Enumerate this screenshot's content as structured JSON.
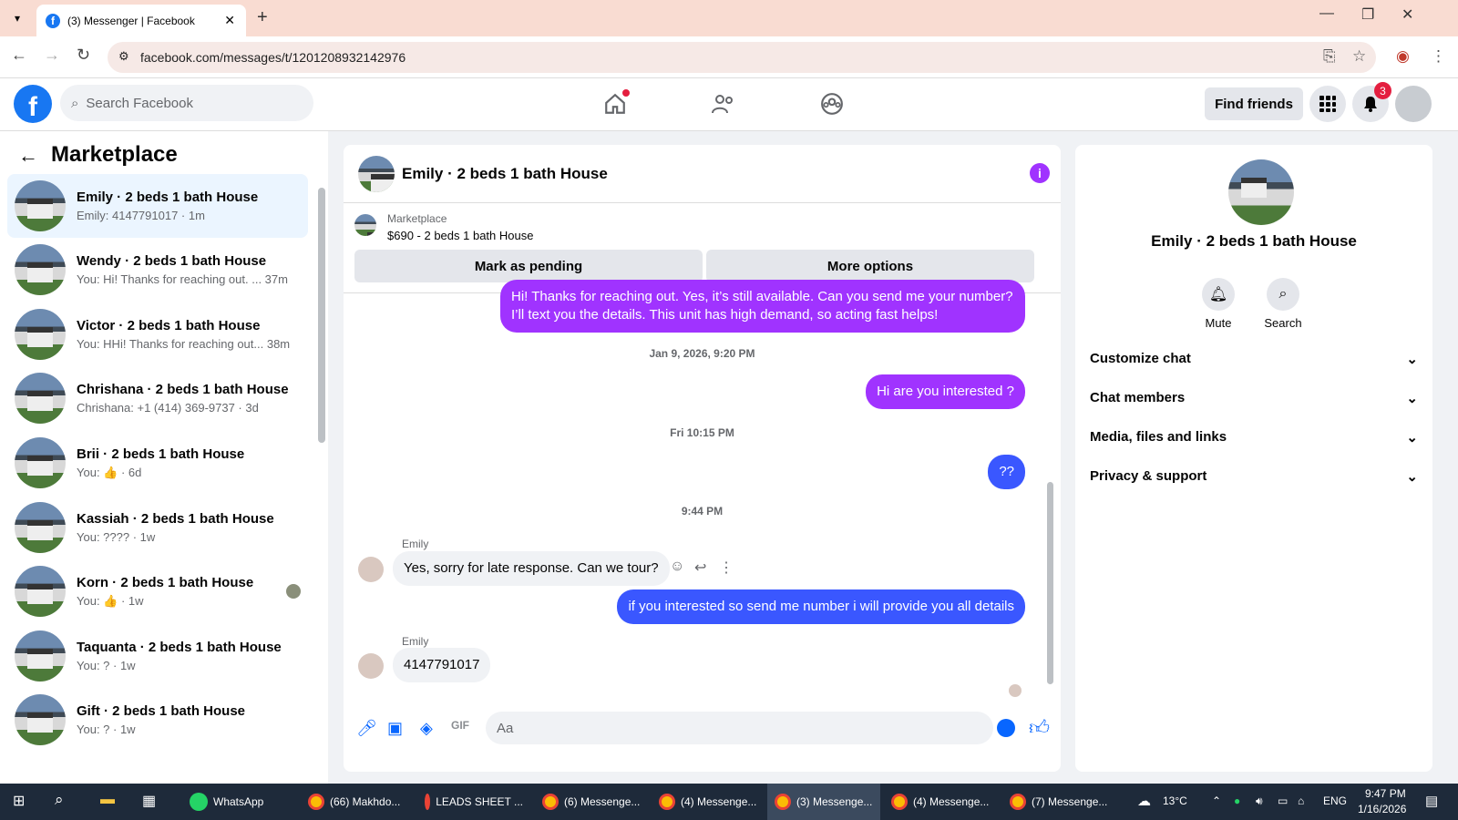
{
  "browser": {
    "tab_title": "(3) Messenger | Facebook",
    "tab_close": "✕",
    "new_tab": "+",
    "url": "facebook.com/messages/t/1201208932142976"
  },
  "fb_header": {
    "search_placeholder": "Search Facebook",
    "find_friends": "Find friends",
    "notif_count": "3"
  },
  "sidebar": {
    "title": "Marketplace",
    "conversations": [
      {
        "name": "Emily · 2 beds 1 bath House",
        "preview": "Emily: 4147791017 · 1m"
      },
      {
        "name": "Wendy · 2 beds 1 bath House",
        "preview": "You: Hi! Thanks for reaching out. ...   37m"
      },
      {
        "name": "Victor · 2 beds 1 bath House",
        "preview": "You: HHi! Thanks for reaching out...  38m"
      },
      {
        "name": "Chrishana · 2 beds 1 bath House",
        "preview": "Chrishana: +1 (414) 369-9737 · 3d"
      },
      {
        "name": "Brii · 2 beds 1 bath House",
        "preview": "You: 👍 · 6d"
      },
      {
        "name": "Kassiah · 2 beds 1 bath House",
        "preview": "You: ???? · 1w"
      },
      {
        "name": "Korn · 2 beds 1 bath House",
        "preview": "You: 👍 · 1w"
      },
      {
        "name": "Taquanta · 2 beds 1 bath House",
        "preview": "You: ? · 1w"
      },
      {
        "name": "Gift · 2 beds 1 bath House",
        "preview": "You: ? · 1w"
      }
    ]
  },
  "chat": {
    "title": "Emily · 2 beds 1 bath House",
    "marketplace_label": "Marketplace",
    "listing": "$690 - 2 beds 1 bath House",
    "mark_pending": "Mark as pending",
    "more_options": "More options",
    "msg1": "Hi! Thanks for reaching out. Yes, it’s still available. Can you send me your number? I’ll text you the details. This unit has high demand, so acting fast helps!",
    "ts1": "Jan 9, 2026, 9:20 PM",
    "msg2": "Hi are you interested ?",
    "ts2": "Fri 10:15 PM",
    "msg3": "??",
    "ts3": "9:44 PM",
    "sender": "Emily",
    "msg4": "Yes, sorry for late response. Can we tour?",
    "msg5": "if you interested so send me number i will provide you all details",
    "msg6": "4147791017",
    "input_placeholder": "Aa"
  },
  "right_panel": {
    "name": "Emily · 2 beds 1 bath House",
    "mute": "Mute",
    "search": "Search",
    "rows": [
      "Customize chat",
      "Chat members",
      "Media, files and links",
      "Privacy & support"
    ]
  },
  "taskbar": {
    "items": [
      "WhatsApp",
      "(66) Makhdo...",
      "LEADS SHEET ...",
      "(6) Messenge...",
      "(4) Messenge...",
      "(3) Messenge...",
      "(4) Messenge...",
      "(7) Messenge..."
    ],
    "temp": "13°C",
    "lang": "ENG",
    "time": "9:47 PM",
    "date": "1/16/2026"
  }
}
